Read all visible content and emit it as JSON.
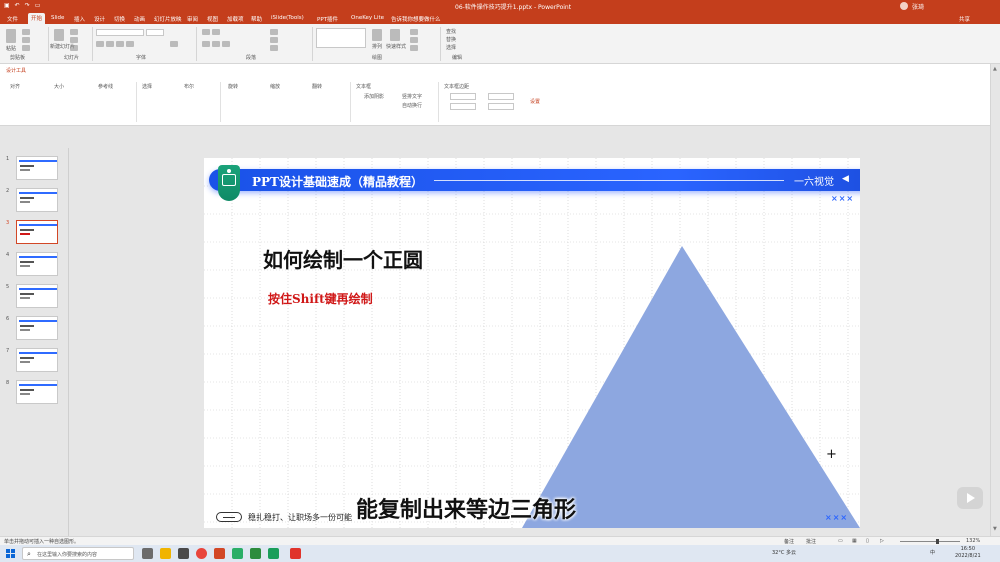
{
  "titlebar": {
    "doc_title": "06-软件操作技巧提升1.pptx - PowerPoint",
    "user": "张琦"
  },
  "tabs": [
    "文件",
    "开始",
    "Slide",
    "插入",
    "设计",
    "切换",
    "动画",
    "幻灯片放映",
    "审阅",
    "视图",
    "加载项",
    "帮助",
    "iSlide(Tools)",
    "PPT插件",
    "OneKey Lite",
    "告诉我你想要做什么"
  ],
  "active_tab": "开始",
  "tabs_right": "共享",
  "ribbon": {
    "groups": [
      "剪贴板",
      "幻灯片",
      "字体",
      "段落",
      "绘图",
      "编辑"
    ],
    "paste": "粘贴",
    "new_slide": "新建幻灯片",
    "arrange": "排列",
    "quick_styles": "快速样式",
    "find": "查找",
    "replace": "替换",
    "select": "选择"
  },
  "design_tools": {
    "title": "设计工具",
    "groups": [
      "对齐",
      "大小",
      "参考线",
      "选择",
      "布尔",
      "旋转",
      "缩放",
      "翻转",
      "文本框",
      "文本框边距"
    ],
    "text_opts": [
      "添加阴影",
      "竖排文字",
      "自动换行",
      "设置"
    ]
  },
  "thumbnails": [
    "1",
    "2",
    "3",
    "4",
    "5",
    "6",
    "7",
    "8"
  ],
  "active_slide": 3,
  "slide": {
    "header_title": "PPT设计基础速成（精品教程）",
    "brand": "一六视觉",
    "heading": "如何绘制一个正圆",
    "subheading": "按住Shift键再绘制",
    "footer": "稳扎稳打、让职场多一份可能",
    "x_marks": "×××",
    "accent_color": "#2a64ff",
    "triangle_color": "#8da7e0",
    "sub_color": "#d01818"
  },
  "caption": "能复制出来等边三角形",
  "status": {
    "left": "单击并拖动可插入一种自选图形。",
    "notes": "备注",
    "comments": "批注",
    "zoom": "132%"
  },
  "taskbar": {
    "search_placeholder": "在这里输入你要搜索的内容",
    "weather": "32°C 多云",
    "time": "16:50",
    "date": "2022/8/21",
    "lang": "中"
  }
}
